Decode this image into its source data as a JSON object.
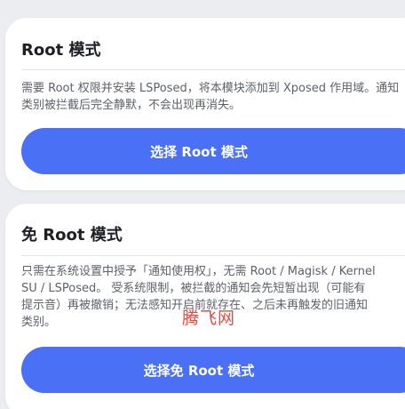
{
  "root_mode": {
    "title": "Root 模式",
    "description": "需要 Root 权限并安装 LSPosed，将本模块添加到 Xposed 作用域。通知类别被拦截后完全静默，不会出现再消失。",
    "button_label": "选择 Root 模式"
  },
  "rootless_mode": {
    "title": "免 Root 模式",
    "description": "只需在系统设置中授予「通知使用权」，无需 Root / Magisk / KernelSU / LSPosed。 受系统限制，被拦截的通知会先短暂出现（可能有提示音）再被撤销；无法感知开启前就存在、之后未再触发的旧通知类别。",
    "button_label": "选择免 Root 模式"
  },
  "watermark": "腾飞网",
  "colors": {
    "accent": "#4a70f6",
    "background": "#ecedf0",
    "card": "#ffffff",
    "watermark": "#e0372b"
  }
}
